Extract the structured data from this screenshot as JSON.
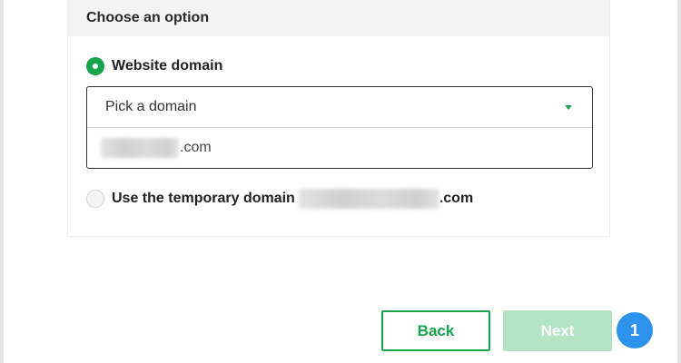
{
  "card": {
    "header": "Choose an option"
  },
  "options": {
    "website_domain_label": "Website domain",
    "temporary_domain_label": "Use the temporary domain",
    "temporary_domain_suffix": ".com"
  },
  "dropdown": {
    "placeholder": "Pick a domain",
    "option_suffix": ".com"
  },
  "buttons": {
    "back": "Back",
    "next": "Next"
  },
  "badge": {
    "number": "1"
  },
  "colors": {
    "accent_green": "#17a44a",
    "disabled_green": "#b3e4c3",
    "badge_blue": "#2c92ea"
  }
}
